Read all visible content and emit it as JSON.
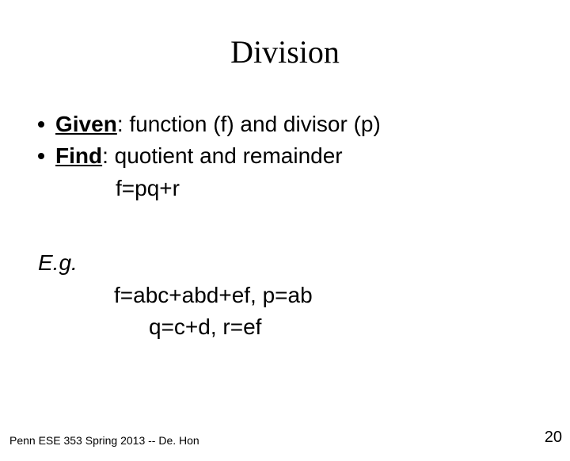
{
  "title": "Division",
  "bullets": {
    "given_label": "Given",
    "given_rest": ":  function (f) and divisor (p)",
    "find_label": "Find",
    "find_rest": ": quotient and remainder"
  },
  "eq_main": "f=pq+r",
  "eg_label": "E.g.",
  "eq_example1": "f=abc+abd+ef,  p=ab",
  "eq_example2": "q=c+d, r=ef",
  "footer": "Penn ESE 353 Spring 2013 -- De. Hon",
  "page_number": "20"
}
